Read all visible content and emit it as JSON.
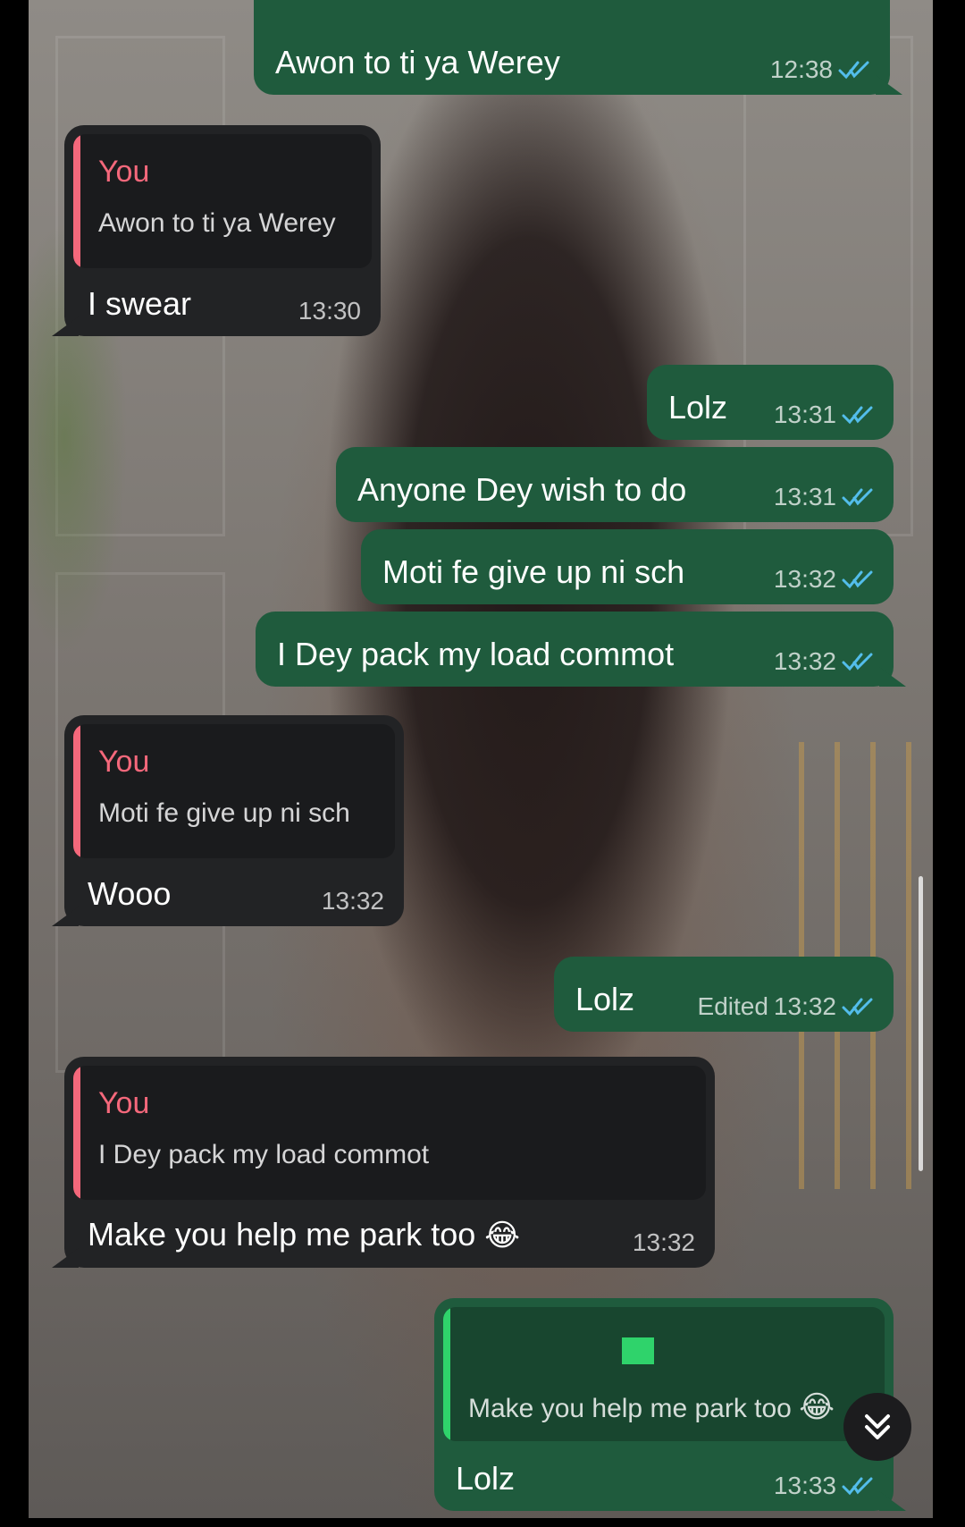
{
  "chat": {
    "messages": [
      {
        "id": "m1",
        "dir": "out",
        "text": "Awon to ti ya Werey",
        "time": "12:38",
        "status": "read"
      },
      {
        "id": "m2",
        "dir": "in",
        "quote_author": "You",
        "quote_text": "Awon to ti ya Werey",
        "text": "I swear",
        "time": "13:30"
      },
      {
        "id": "m3",
        "dir": "out",
        "text": "Lolz",
        "time": "13:31",
        "status": "read"
      },
      {
        "id": "m4",
        "dir": "out",
        "text": "Anyone Dey wish to do",
        "time": "13:31",
        "status": "read"
      },
      {
        "id": "m5",
        "dir": "out",
        "text": "Moti fe give up ni sch",
        "time": "13:32",
        "status": "read"
      },
      {
        "id": "m6",
        "dir": "out",
        "text": "I Dey pack my load commot",
        "time": "13:32",
        "status": "read"
      },
      {
        "id": "m7",
        "dir": "in",
        "quote_author": "You",
        "quote_text": "Moti fe give up ni sch",
        "text": "Wooo",
        "time": "13:32"
      },
      {
        "id": "m8",
        "dir": "out",
        "text": "Lolz",
        "edited_label": "Edited",
        "time": "13:32",
        "status": "read"
      },
      {
        "id": "m9",
        "dir": "in",
        "quote_author": "You",
        "quote_text": "I Dey pack my load commot",
        "text": "Make you help me park too",
        "emoji": "😂",
        "time": "13:32"
      },
      {
        "id": "m10",
        "dir": "out",
        "quote_text": "Make you help me park too",
        "emoji": "😂",
        "text": "Lolz",
        "time": "13:33",
        "status": "read"
      }
    ]
  },
  "colors": {
    "outgoing_bubble": "#1f5b3d",
    "incoming_bubble": "#222325",
    "quote_author": "#f4687b",
    "quote_bar_in": "#f4687b",
    "quote_bar_out": "#2fd36b",
    "read_ticks": "#53bdeb"
  },
  "icons": {
    "read_status": "double-check-icon",
    "scroll_down": "chevron-double-down-icon"
  }
}
